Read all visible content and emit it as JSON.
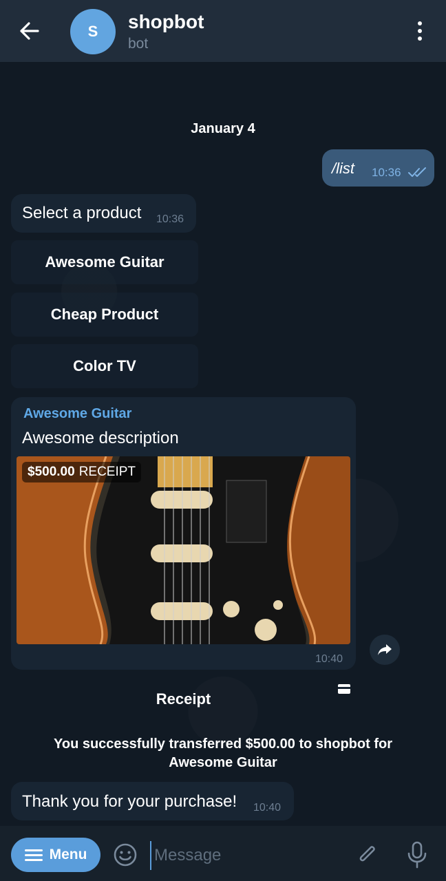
{
  "header": {
    "avatar_letter": "S",
    "title": "shopbot",
    "subtitle": "bot",
    "back_icon": "arrow-left-icon",
    "menu_icon": "kebab-icon"
  },
  "chat": {
    "date": "January 4",
    "outgoing": {
      "text": "/list",
      "time": "10:36"
    },
    "select_message": {
      "text": "Select a product",
      "time": "10:36"
    },
    "keyboard_buttons": [
      "Awesome Guitar",
      "Cheap Product",
      "Color TV"
    ],
    "invoice": {
      "title": "Awesome Guitar",
      "description": "Awesome description",
      "price": "$500.00",
      "price_label": "RECEIPT",
      "time": "10:40"
    },
    "receipt_button": "Receipt",
    "service_message": "You successfully transferred $500.00 to shopbot for Awesome Guitar",
    "thanks_message": {
      "text": "Thank you for your purchase!",
      "time": "10:40"
    }
  },
  "input_bar": {
    "menu_label": "Menu",
    "placeholder": "Message"
  },
  "colors": {
    "header_bg": "#212d3b",
    "accent": "#5a9ddb",
    "link": "#5fa8e6",
    "outgoing_bubble": "#3a5a7a",
    "incoming_bubble": "#182533"
  }
}
